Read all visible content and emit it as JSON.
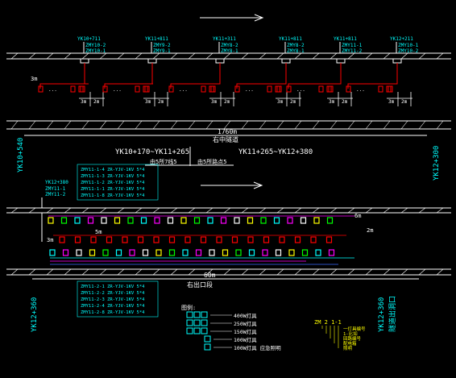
{
  "colors": {
    "background": "#000000",
    "structure": "#ffffff",
    "cyan_text": "#00ffff",
    "yellow_text": "#ffff00",
    "red_fixture": "#ff0000",
    "green_fixture": "#00ff00",
    "blue_fixture": "#3a6bff",
    "magenta": "#ff00ff"
  },
  "top_section": {
    "circuit_labels": [
      {
        "id": "YK10+711",
        "lines": [
          "ZMY10-2",
          "ZMY10-1"
        ]
      },
      {
        "id": "YK11+811",
        "lines": [
          "ZMY9-2",
          "ZMY9-1"
        ]
      },
      {
        "id": "YK11+311",
        "lines": [
          "ZMY8-2",
          "ZMY8-1"
        ]
      },
      {
        "id": "YK11+811",
        "lines": [
          "ZMY8-2",
          "ZMY8-1"
        ]
      },
      {
        "id": "YK11+811",
        "lines": [
          "ZMY11-1",
          "ZMY11-2"
        ]
      },
      {
        "id": "YK12+211",
        "lines": [
          "ZMY10-1",
          "ZMY10-2"
        ]
      }
    ],
    "dim_3m": "3m",
    "dim_2m": "2m",
    "total_length": "1760m",
    "tunnel_name": "右中隧道",
    "left_station": "YK10+540",
    "right_station": "YK12+300",
    "range_left": "YK10+170~YK11+265",
    "range_right": "YK11+265~YK12+380",
    "range_left_sub": "由5所7线5",
    "range_right_sub": "由5所路点5"
  },
  "bottom_section": {
    "station_label": "YK12+380",
    "circuit_top": [
      "ZMY11-1",
      "ZMY11-2"
    ],
    "cable_list_top": [
      "ZMY11-1-4  ZR-YJV-1KV 5*4",
      "ZMY11-1-3  ZR-YJV-1KV 5*4",
      "ZMY11-1-2  ZR-YJV-1KV 5*4",
      "ZMY11-1-1  ZR-YJV-1KV 5*4",
      "ZMY11-1-8  ZR-YJV-1KV 5*4"
    ],
    "dim_6m": "6m",
    "dim_5m": "5m",
    "dim_3m": "3m",
    "dim_2m": "2m",
    "total_length": "60m",
    "exit_label": "右出口段",
    "left_station": "YK12+360",
    "right_station": "YK12+360",
    "right_note": "隧道出洞口",
    "cable_list_bottom": [
      "ZMY11-2-1  ZR-YJV-1KV 5*4",
      "ZMY11-2-2  ZR-YJV-1KV 5*4",
      "ZMY11-2-3  ZR-YJV-1KV 5*4",
      "ZMY11-2-4  ZR-YJV-1KV 5*4",
      "ZMY11-2-8  ZR-YJV-1KV 5*4"
    ]
  },
  "legend": {
    "title": "图例:",
    "items": [
      {
        "label": "400W",
        "desc": "400W灯具"
      },
      {
        "label": "250W",
        "desc": "250W灯具"
      },
      {
        "label": "150W",
        "desc": "150W灯具"
      },
      {
        "label": "100W",
        "desc": "100W灯具"
      },
      {
        "label": "100W",
        "desc": "100W灯具 应急照明"
      }
    ],
    "code_title": "ZM 2 1-1",
    "code_notes": [
      "一灯具编号",
      "1-比如",
      "回路编号",
      "配电箱",
      "照明"
    ]
  }
}
